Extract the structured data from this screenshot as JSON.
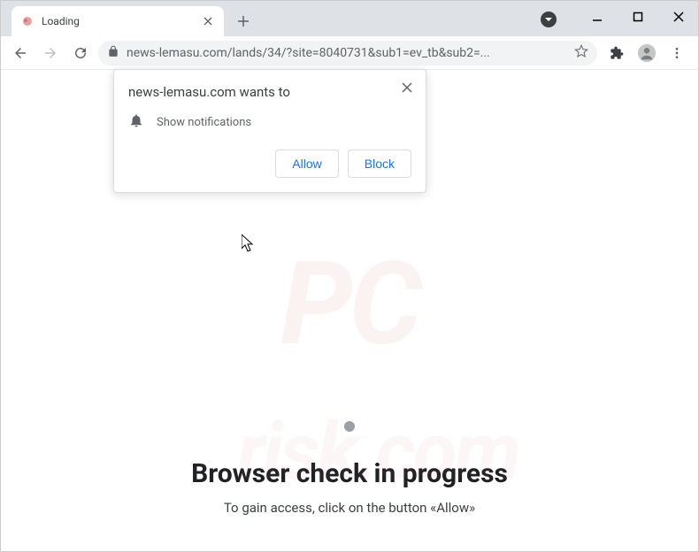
{
  "tab": {
    "title": "Loading"
  },
  "omnibox": {
    "url": "news-lemasu.com/lands/34/?site=8040731&sub1=ev_tb&sub2=..."
  },
  "permission": {
    "title": "news-lemasu.com wants to",
    "item": "Show notifications",
    "allow": "Allow",
    "block": "Block"
  },
  "page": {
    "heading": "Browser check in progress",
    "subtext": "To gain access, click on the button «Allow»"
  }
}
